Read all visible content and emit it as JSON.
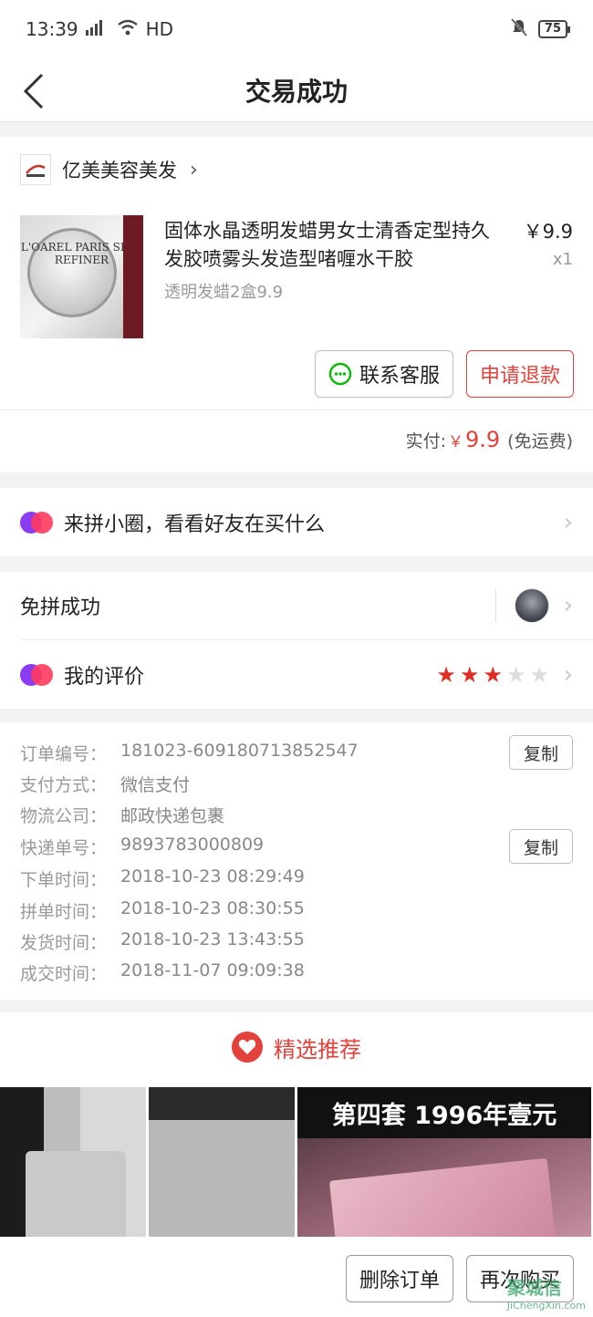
{
  "status_bar": {
    "time": "13:39",
    "network": "HD",
    "battery": "75"
  },
  "nav": {
    "title": "交易成功"
  },
  "shop": {
    "name": "亿美美容美发"
  },
  "product": {
    "title": "固体水晶透明发蜡男女士清香定型持久发胶喷雾头发造型啫喱水干胶",
    "spec": "透明发蜡2盒9.9",
    "price": "￥9.9",
    "quantity": "x1",
    "image_text": "L'OAREL PARIS SKIN REFINER"
  },
  "actions": {
    "contact": "联系客服",
    "refund": "申请退款"
  },
  "payment": {
    "label": "实付:",
    "currency": "￥",
    "amount": "9.9",
    "note": "(免运费)"
  },
  "circle": {
    "label": "来拼小圈，看看好友在买什么"
  },
  "group": {
    "label": "免拼成功"
  },
  "review": {
    "label": "我的评价",
    "rating": 3,
    "max": 5
  },
  "order_info": [
    {
      "key": "订单编号：",
      "value": "181023-609180713852547",
      "copy": true
    },
    {
      "key": "支付方式：",
      "value": "微信支付",
      "copy": false
    },
    {
      "key": "物流公司：",
      "value": "邮政快递包裹",
      "copy": false
    },
    {
      "key": "快递单号：",
      "value": "9893783000809",
      "copy": true
    },
    {
      "key": "下单时间：",
      "value": "2018-10-23 08:29:49",
      "copy": false
    },
    {
      "key": "拼单时间：",
      "value": "2018-10-23 08:30:55",
      "copy": false
    },
    {
      "key": "发货时间：",
      "value": "2018-10-23 13:43:55",
      "copy": false
    },
    {
      "key": "成交时间：",
      "value": "2018-11-07 09:09:38",
      "copy": false
    }
  ],
  "copy_label": "复制",
  "recommend": {
    "title": "精选推荐",
    "banner": "第四套 1996年壹元"
  },
  "bottom": {
    "delete": "删除订单",
    "rebuy": "再次购买"
  },
  "watermark": {
    "main": "聚城信",
    "sub": "JiChengXin.com"
  },
  "colors": {
    "accent": "#e2423b",
    "star": "#e02e24",
    "wechat": "#09bb07"
  }
}
